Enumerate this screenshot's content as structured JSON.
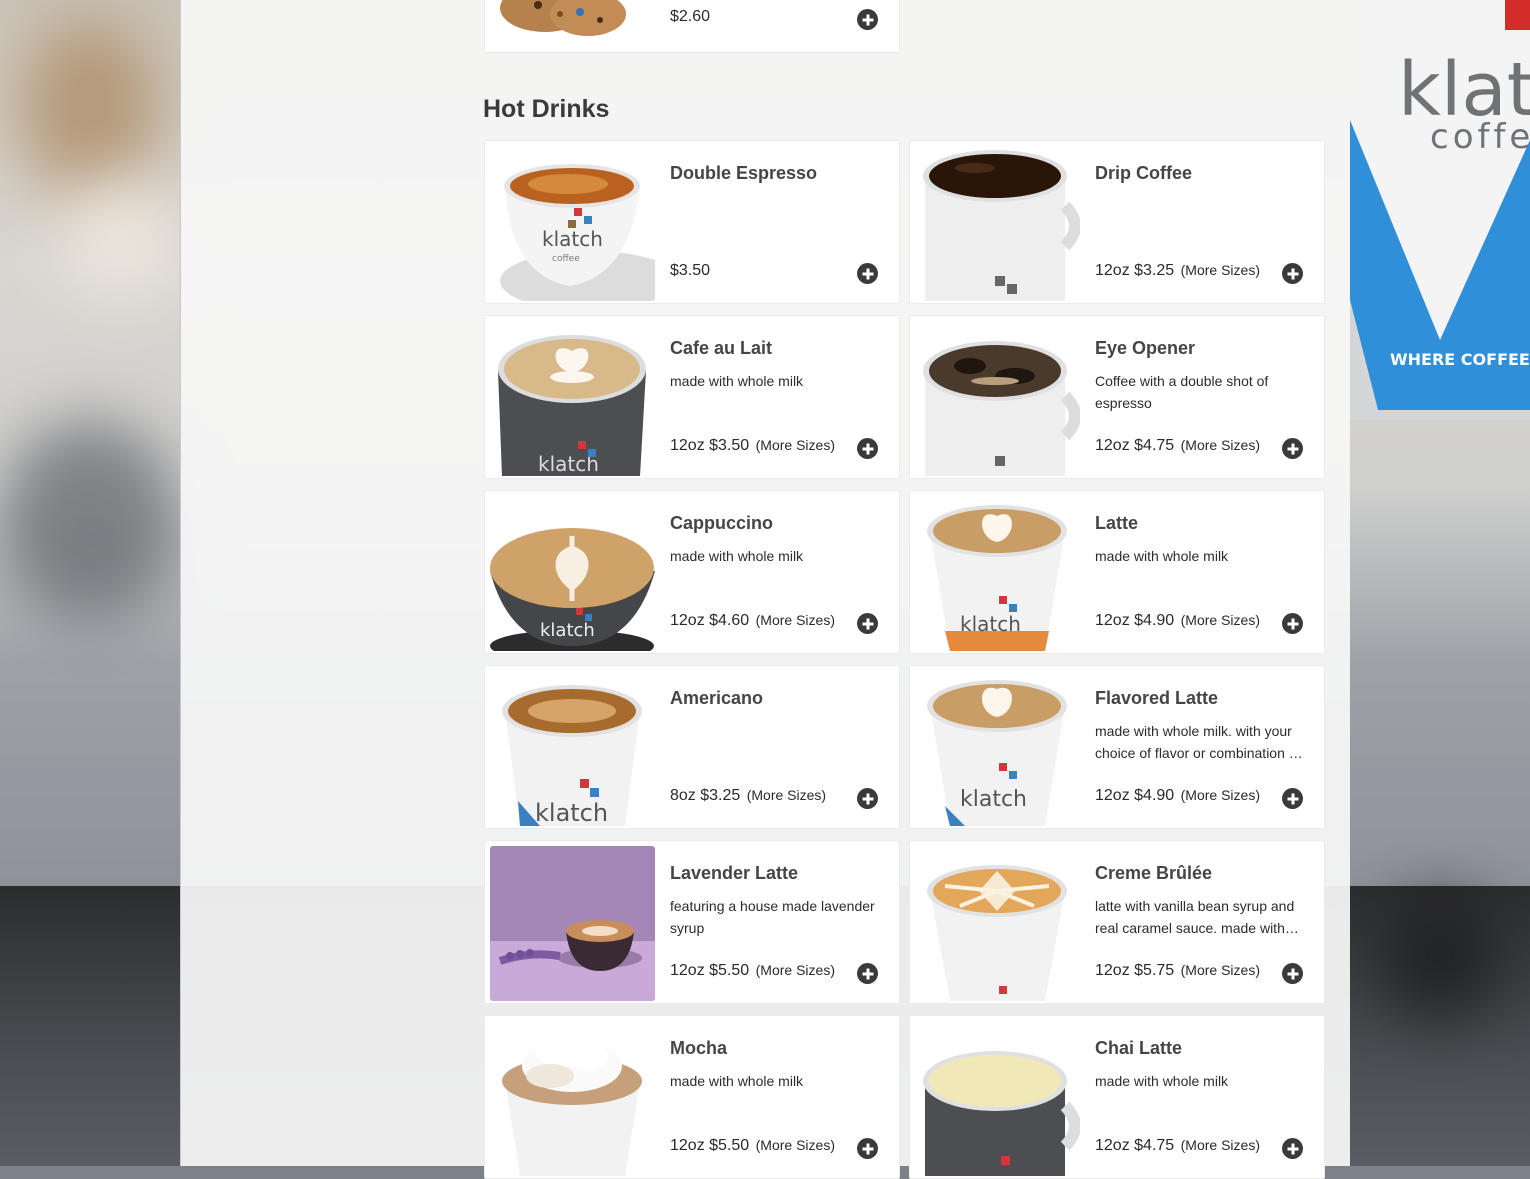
{
  "colors": {
    "panel": "#f6f6f6",
    "card": "#ffffff",
    "text": "#454545",
    "add_button": "#3a3a3a"
  },
  "top_item": {
    "price": "$2.60",
    "image": "cookies-photo",
    "add_icon": "plus-circle-icon"
  },
  "section": {
    "title": "Hot Drinks"
  },
  "more_sizes_label": "(More Sizes)",
  "items": [
    {
      "name": "Double Espresso",
      "desc": "",
      "price": "$3.50",
      "more": "",
      "image": "espresso-cup"
    },
    {
      "name": "Drip Coffee",
      "desc": "",
      "price": "12oz $3.25",
      "more": "(More Sizes)",
      "image": "drip-mug"
    },
    {
      "name": "Cafe au Lait",
      "desc": "made with whole milk",
      "price": "12oz $3.50",
      "more": "(More Sizes)",
      "image": "latte-art-dark-mug"
    },
    {
      "name": "Eye Opener",
      "desc": "Coffee with a double shot of espresso",
      "price": "12oz $4.75",
      "more": "(More Sizes)",
      "image": "eye-opener-mug"
    },
    {
      "name": "Cappuccino",
      "desc": "made with whole milk",
      "price": "12oz $4.60",
      "more": "(More Sizes)",
      "image": "cappuccino-dark-cup"
    },
    {
      "name": "Latte",
      "desc": "made with whole milk",
      "price": "12oz $4.90",
      "more": "(More Sizes)",
      "image": "latte-paper-cup"
    },
    {
      "name": "Americano",
      "desc": "",
      "price": "8oz $3.25",
      "more": "(More Sizes)",
      "image": "americano-paper-cup"
    },
    {
      "name": "Flavored Latte",
      "desc": "made with whole milk. with your choice of flavor or combination of flavors",
      "price": "12oz $4.90",
      "more": "(More Sizes)",
      "image": "flavored-latte-cup"
    },
    {
      "name": "Lavender Latte",
      "desc": "featuring a house made lavender syrup",
      "price": "12oz $5.50",
      "more": "(More Sizes)",
      "image": "lavender-latte-photo"
    },
    {
      "name": "Creme Brûlée",
      "desc": "latte with vanilla bean syrup and real caramel sauce. made with whole milk",
      "price": "12oz $5.75",
      "more": "(More Sizes)",
      "image": "creme-brulee-cup"
    },
    {
      "name": "Mocha",
      "desc": "made with whole milk",
      "price": "12oz $5.50",
      "more": "(More Sizes)",
      "image": "mocha-whipped-cup"
    },
    {
      "name": "Chai Latte",
      "desc": "made with whole milk",
      "price": "12oz $4.75",
      "more": "(More Sizes)",
      "image": "chai-latte-mug"
    }
  ]
}
